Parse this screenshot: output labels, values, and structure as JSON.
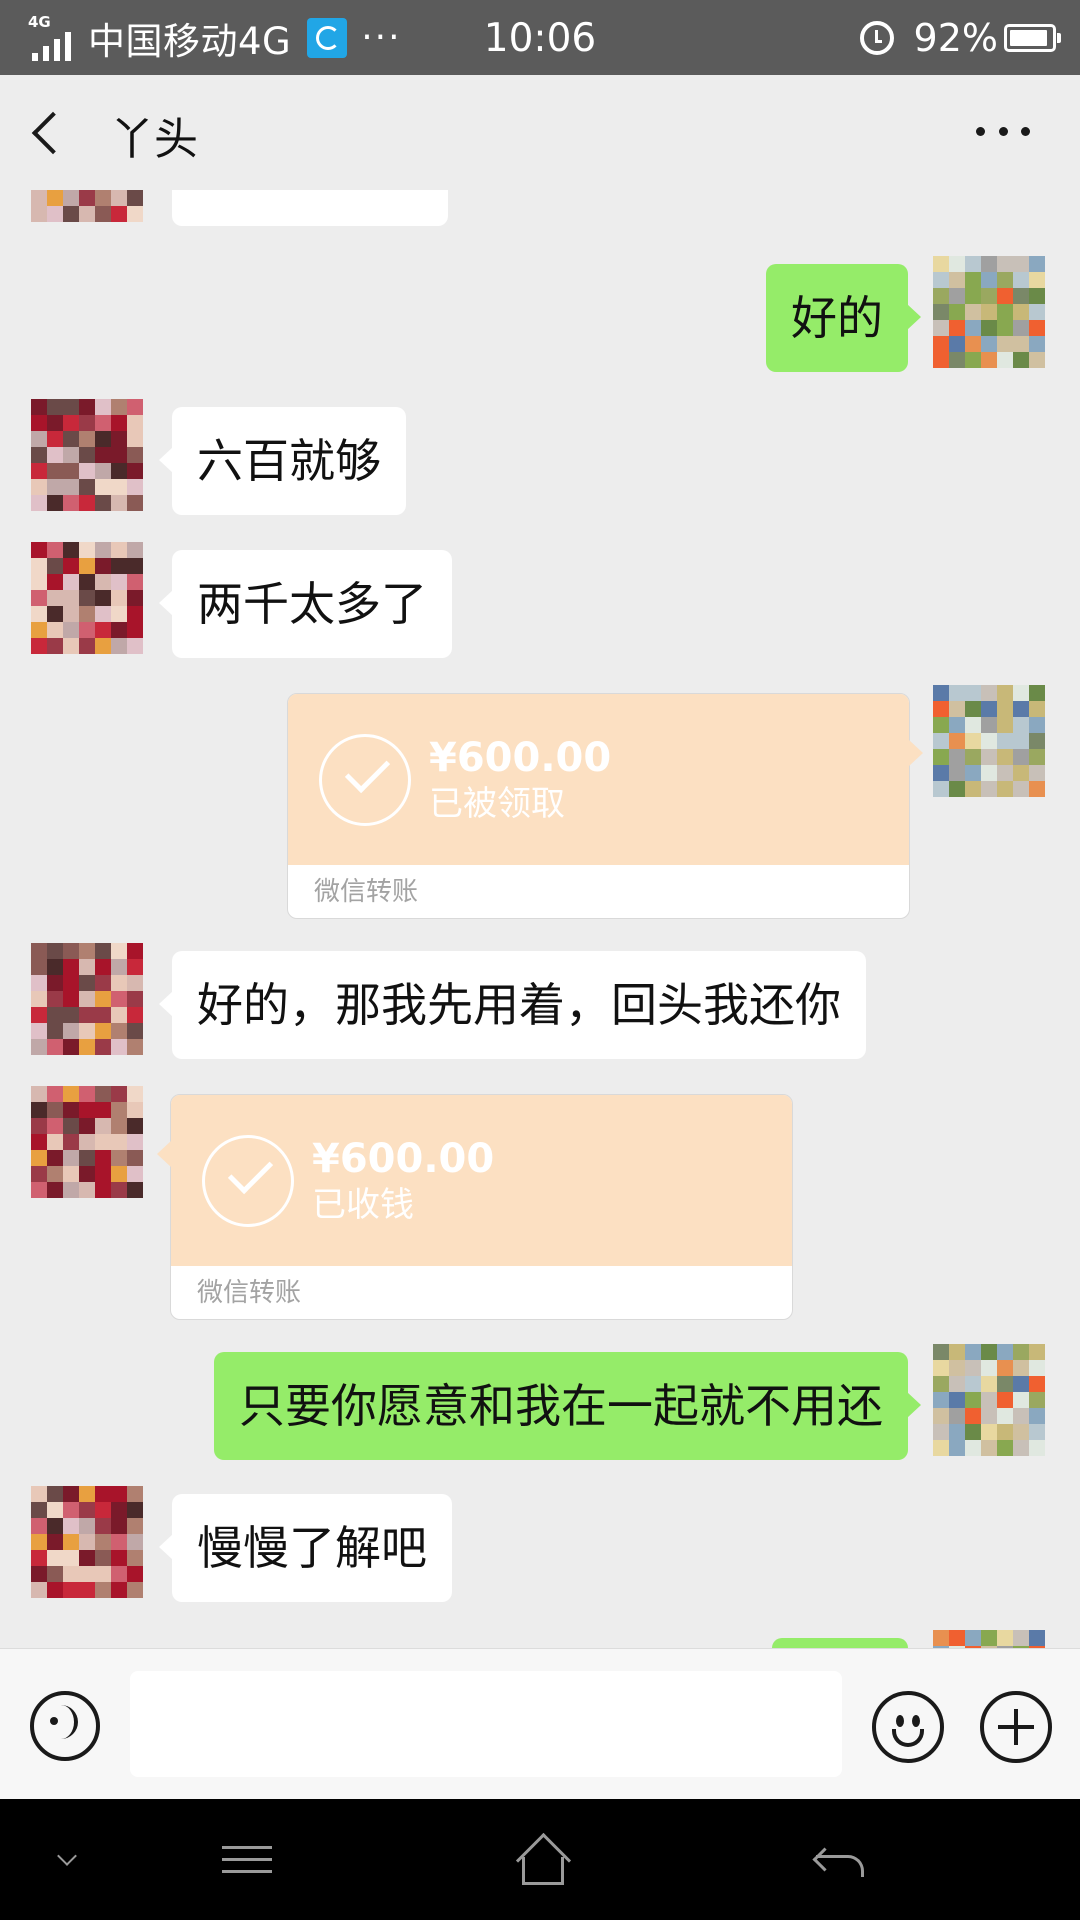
{
  "status_bar": {
    "network_tag": "4G",
    "carrier": "中国移动4G",
    "overflow": "···",
    "time": "10:06",
    "battery_percent": "92%",
    "battery_level": 0.92
  },
  "header": {
    "title": "丫头"
  },
  "messages": [
    {
      "type": "text",
      "sender": "me",
      "text": "好的"
    },
    {
      "type": "text",
      "sender": "other",
      "text": "六百就够"
    },
    {
      "type": "text",
      "sender": "other",
      "text": "两千太多了"
    },
    {
      "type": "transfer",
      "sender": "me",
      "amount": "¥600.00",
      "status": "已被领取",
      "label": "微信转账"
    },
    {
      "type": "text",
      "sender": "other",
      "text": "好的，那我先用着，回头我还你"
    },
    {
      "type": "transfer",
      "sender": "other",
      "amount": "¥600.00",
      "status": "已收钱",
      "label": "微信转账"
    },
    {
      "type": "text",
      "sender": "me",
      "text": "只要你愿意和我在一起就不用还"
    },
    {
      "type": "text",
      "sender": "other",
      "text": "慢慢了解吧"
    }
  ],
  "colors": {
    "bubble_out": "#95ec69",
    "bubble_in": "#ffffff",
    "transfer_card": "#fce0c2",
    "background": "#ededed"
  }
}
